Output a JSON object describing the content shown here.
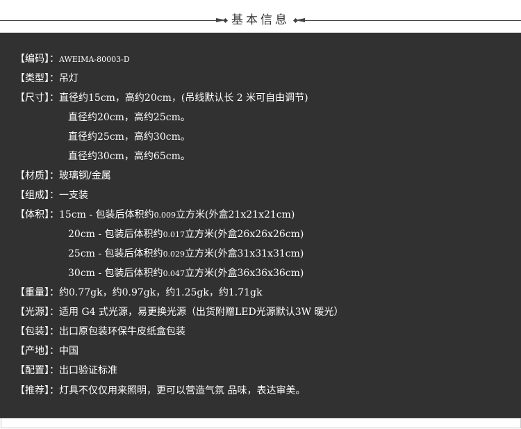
{
  "header": {
    "title": "基本信息"
  },
  "specs": {
    "code": {
      "label": "【编码】：",
      "value": "AWEIMA-80003-D"
    },
    "type": {
      "label": "【类型】：",
      "value": "吊灯"
    },
    "size": {
      "label": "【尺寸】：",
      "lines": [
        "直径约15cm，高约20cm，(吊线默认长 2 米可自由调节)",
        "直径约20cm，高约25cm。",
        "直径约25cm，高约30cm。",
        "直径约30cm，高约65cm。"
      ]
    },
    "material": {
      "label": "【材质】：",
      "value": "玻璃钢/金属"
    },
    "composition": {
      "label": "【组成】：",
      "value": "一支装"
    },
    "volume": {
      "label": "【体积】：",
      "lines": [
        {
          "pre": "15cm - 包装后体积约",
          "num": "0.009",
          "post": "立方米(外盒21x21x21cm)"
        },
        {
          "pre": "20cm - 包装后体积约",
          "num": "0.017",
          "post": "立方米(外盒26x26x26cm)"
        },
        {
          "pre": "25cm - 包装后体积约",
          "num": "0.029",
          "post": "立方米(外盒31x31x31cm)"
        },
        {
          "pre": "30cm - 包装后体积约",
          "num": "0.047",
          "post": "立方米(外盒36x36x36cm)"
        }
      ]
    },
    "weight": {
      "label": "【重量】：",
      "value": "约0.77gk，约0.97gk，约1.25gk，约1.71gk"
    },
    "light": {
      "label": "【光源】：",
      "value": "适用 G4 式光源，易更换光源（出货附赠LED光源默认3W 暖光）"
    },
    "packaging": {
      "label": "【包装】：",
      "value": "出口原包装环保牛皮纸盒包装"
    },
    "origin": {
      "label": "【产地】：",
      "value": "中国"
    },
    "config": {
      "label": "【配置】：",
      "value": "出口验证标准"
    },
    "recommend": {
      "label": "【推荐】：",
      "value": "灯具不仅仅用来照明，更可以营造气氛 品味，表达审美。"
    }
  },
  "colors": {
    "panel_bg": "#313131",
    "text": "#ffffff",
    "header_text": "#333333"
  }
}
